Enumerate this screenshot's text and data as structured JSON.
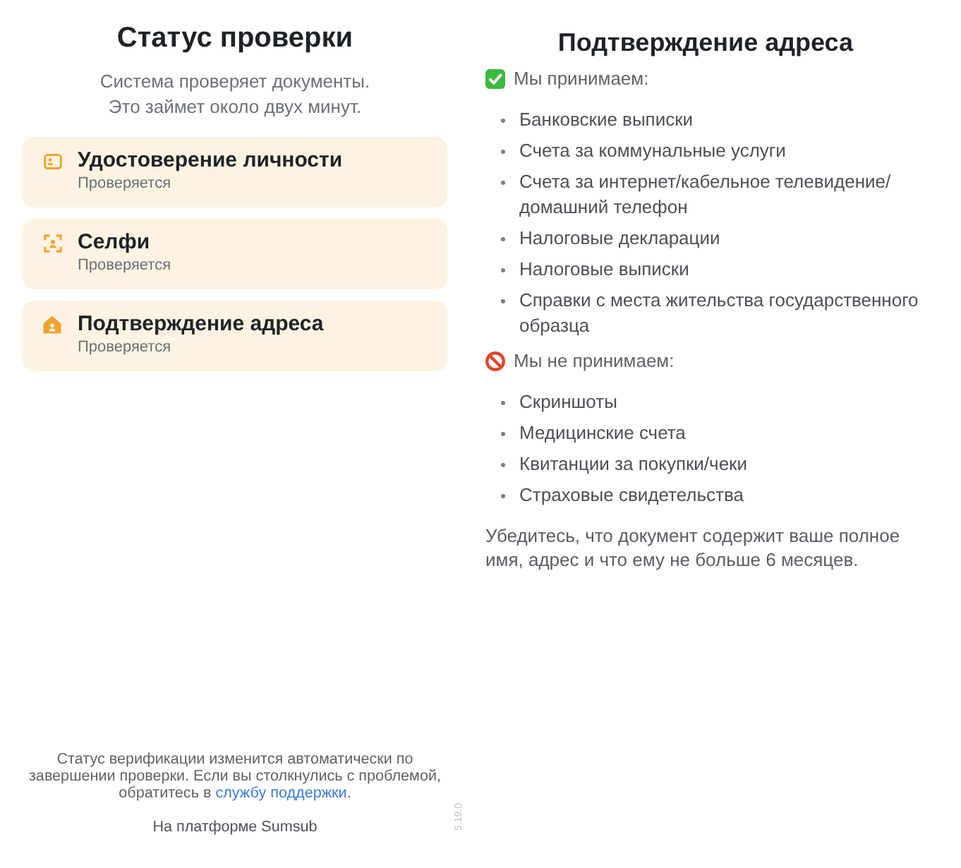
{
  "verification_status": {
    "title": "Статус проверки",
    "subtitle": "Система проверяет документы.\nЭто займет около двух минут.",
    "steps": [
      {
        "kind": "id",
        "title": "Удостоверение личности",
        "status": "Проверяется"
      },
      {
        "kind": "selfie",
        "title": "Селфи",
        "status": "Проверяется"
      },
      {
        "kind": "address",
        "title": "Подтверждение адреса",
        "status": "Проверяется"
      }
    ]
  },
  "footer": {
    "note": "Статус верификации изменится автоматически по завершении проверки. Если вы столкнулись с проблемой, обратитесь в",
    "link": "службу поддержки",
    "note_end": ".",
    "powered_by": "На платформе Sumsub",
    "version": "5.19.0"
  },
  "address_requirements": {
    "title": "Подтверждение адреса",
    "sections": [
      {
        "kind": "accepted",
        "heading": "Мы принимаем:",
        "items": [
          "Банковские выписки",
          "Счета за коммунальные услуги",
          "Счета за интернет/кабельное телевидение/домашний телефон",
          "Налоговые декларации",
          "Налоговые выписки",
          "Справки с места жительства государственного образца"
        ]
      },
      {
        "kind": "rejected",
        "heading": "Мы не принимаем:",
        "items": [
          "Скриншоты",
          "Медицинские счета",
          "Квитанции за покупки/чеки",
          "Страховые свидетельства"
        ]
      }
    ],
    "note": "Убедитесь, что документ содержит ваше полное имя, адрес и что ему не больше 6 месяцев."
  }
}
